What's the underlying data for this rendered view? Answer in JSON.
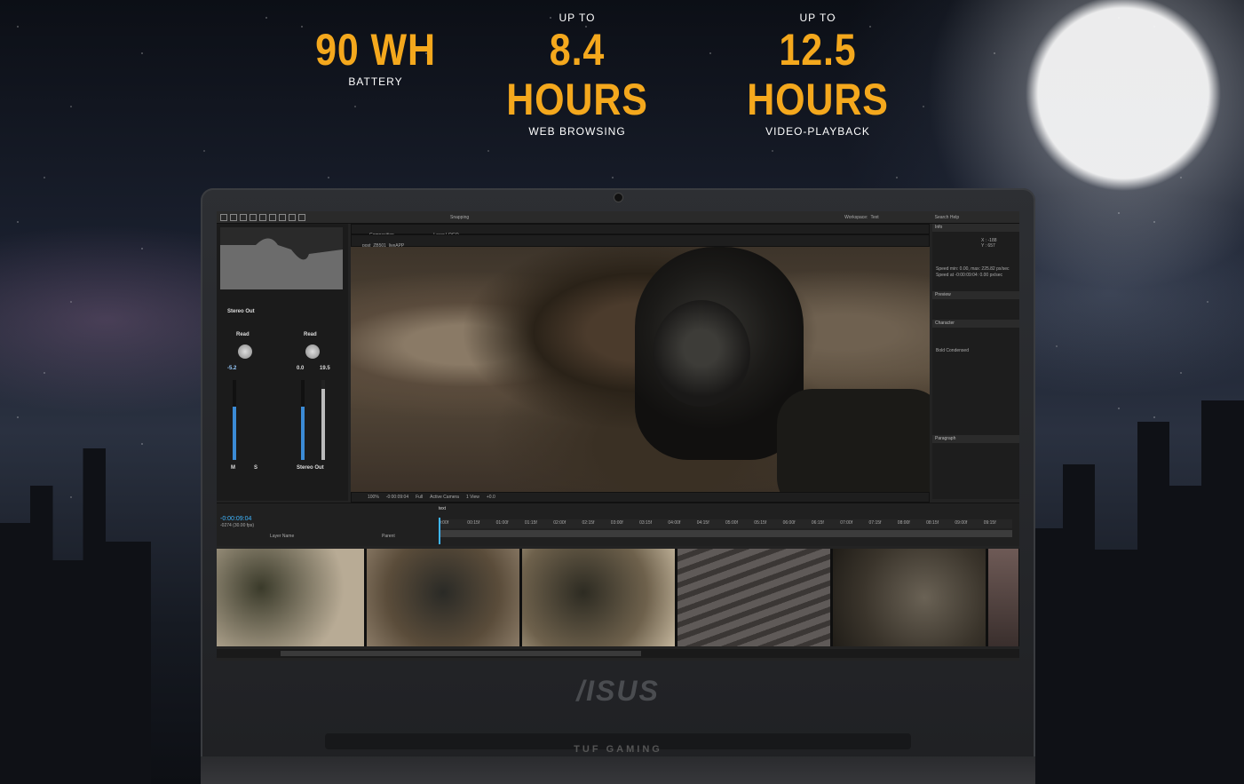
{
  "stats": [
    {
      "upto": "",
      "value": "90 WH",
      "label": "BATTERY"
    },
    {
      "upto": "UP TO",
      "value": "8.4 HOURS",
      "label": "WEB BROWSING"
    },
    {
      "upto": "UP TO",
      "value": "12.5 HOURS",
      "label": "VIDEO-PLAYBACK"
    }
  ],
  "colors": {
    "accent": "#f4a81d"
  },
  "laptop": {
    "brand": "/ISUS",
    "tuf": "TUF GAMING"
  },
  "app": {
    "toolbar": {
      "snapping": "Snapping",
      "workspace_label": "Workspace:",
      "workspace_value": "Text",
      "search": "Search Help"
    },
    "comp_tab": "Composition",
    "layer_tab": "Layer LOGO",
    "comp_name": "post_ZB501_liveAPP",
    "viewer_zoom": "100%",
    "viewer_timecode": "-0:00:09:04",
    "viewer_res": "Full",
    "viewer_camera": "Active Camera",
    "viewer_views": "1 View",
    "viewer_exposure": "+0.0",
    "mixer": {
      "stereo_out_title": "Stereo Out",
      "read_left": "Read",
      "read_right": "Read",
      "val_left": "-5.2",
      "val_mid": "0.0",
      "val_right": "19.5",
      "bottom_label": "Stereo Out",
      "m": "M",
      "s": "S"
    },
    "info_tab": "Info",
    "info_coords": "X : -188\nY : 657",
    "info_speed": "Speed min: 0.00, max: 225.82 px/sec",
    "info_speed2": "Speed at -0:00:09:04: 0.00 px/sec",
    "preview_tab": "Preview",
    "character_tab": "Character",
    "character_font": "Bold Condensed",
    "paragraph_tab": "Paragraph",
    "timeline": {
      "timecode": "-0:00:09:04",
      "fps": "-0274 (30.00 fps)",
      "layer_name_header": "Layer Name",
      "parent_header": "Parent",
      "tab": "text"
    },
    "ruler_ticks": [
      "0:00f",
      "00:15f",
      "01:00f",
      "01:15f",
      "02:00f",
      "02:15f",
      "03:00f",
      "03:15f",
      "04:00f",
      "04:15f",
      "05:00f",
      "05:15f",
      "06:00f",
      "06:15f",
      "07:00f",
      "07:15f",
      "08:00f",
      "08:15f",
      "09:00f",
      "09:15f"
    ]
  }
}
